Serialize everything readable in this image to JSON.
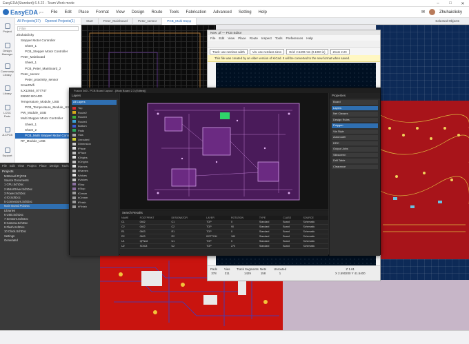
{
  "easyeda": {
    "window_title": "EasyEDA(Standard) 6.5.22 - Team Work mode",
    "logo_text": "EasyEDA",
    "logo_sub": "pro",
    "menu": [
      "File",
      "Edit",
      "Place",
      "Format",
      "View",
      "Design",
      "Route",
      "Tools",
      "Fabrication",
      "Advanced",
      "Setting",
      "Help"
    ],
    "username": "Zhuhaiclicky",
    "left_rail": [
      "Project",
      "Design Manager",
      "Commonly Library",
      "Library",
      "LCSC Parts",
      "JLCPCB",
      "Support"
    ],
    "project_tabs": [
      "All Projects(37)",
      "Opened Projects(1)"
    ],
    "filter_placeholder": "Filter",
    "tree": [
      "Zhuhaiclicky",
      "Stepper Motor Controller",
      "Sheet_1",
      "PCB_Stepper Motor Controller",
      "Peter_Mainboard",
      "Sheet_1",
      "PCB_Peter_Mainboard_2",
      "Peter_sensor",
      "Peter_proximity_sensor",
      "SmartWifi",
      "ILX12654_077747",
      "EB000 BOARD",
      "Temperature_Module_USB",
      "PCB_Temperature_Module_USB",
      "PW_Module_USB",
      "Multi Stepper Motor Controller",
      "Sheet_1",
      "Sheet_2",
      "PCB_Multi Stepper Motor Controller",
      "RF_Module_USB"
    ],
    "tabs": [
      "Start",
      "Peter_Mainboard",
      "Peter_sensor",
      "PCB_Multi Stepp"
    ],
    "selected_objects_label": "Selected Objects"
  },
  "altium": {
    "menu": [
      "File",
      "Edit",
      "View",
      "Project",
      "Place",
      "Design",
      "Tools",
      "Route",
      "Reports"
    ],
    "projects_label": "Projects",
    "rows": [
      "MSBoard.PrjPCB",
      "Source Documents",
      "1 CPU.SchDoc",
      "2 MotorDriver.SchDoc",
      "3 Power.SchDoc",
      "4 IO.SchDoc",
      "5 Connectors.SchDoc",
      "Main Board.PcbDoc",
      "Libraries",
      "6 USB.SchDoc",
      "7 Sensors.SchDoc",
      "8 Camera.SchDoc",
      "9 Flash.SchDoc",
      "10 Clock.SchDoc",
      "Settings",
      "Generated"
    ],
    "selected_index": 7,
    "footer": "Project Group 1.DsnWrk"
  },
  "kicad": {
    "title": "New .pf — PCB Editor",
    "menu": [
      "File",
      "Edit",
      "View",
      "Place",
      "Route",
      "Inspect",
      "Tools",
      "Preferences",
      "Help"
    ],
    "track_select": "Track: use netclass width",
    "via_select": "Via: use netclass sizes",
    "grid_select": "Grid: 2.5400 mm (0.1000 in)",
    "zoom_select": "Zoom 2.20",
    "notice": "This file was created by an older version of KiCad. It will be converted to the new format when saved.",
    "board_text": "ALL VIAS MUST BE TENTED",
    "status": [
      {
        "label": "Pads",
        "value": "378"
      },
      {
        "label": "Vias",
        "value": "311"
      },
      {
        "label": "Track Segments",
        "value": "1429"
      },
      {
        "label": "Nets",
        "value": "158"
      },
      {
        "label": "Unrouted",
        "value": "1"
      }
    ],
    "coord_z": "Z 1.61",
    "coord_xy": "X 2.590200  Y 41.5400"
  },
  "eagle": {
    "title": "Fusion 360 - PCB Board Layout - [Main Board 2.3 (Edited)]",
    "layers_title": "Layers",
    "layer_filter": "All Layers",
    "layers": [
      {
        "name": "Top",
        "color": "#d63030"
      },
      {
        "name": "Route2",
        "color": "#d4a81a"
      },
      {
        "name": "Route3",
        "color": "#3caf3c"
      },
      {
        "name": "Route4",
        "color": "#3ca0d4"
      },
      {
        "name": "Bottom",
        "color": "#3a5cd4"
      },
      {
        "name": "Pads",
        "color": "#2aa85a"
      },
      {
        "name": "Vias",
        "color": "#aaaaaa"
      },
      {
        "name": "Unrouted",
        "color": "#d0d030"
      },
      {
        "name": "Dimension",
        "color": "#cccccc"
      },
      {
        "name": "tPlace",
        "color": "#e0e0e0"
      },
      {
        "name": "bPlace",
        "color": "#c0c0c0"
      },
      {
        "name": "tOrigins",
        "color": "#e0e0e0"
      },
      {
        "name": "bOrigins",
        "color": "#c0c0c0"
      },
      {
        "name": "tNames",
        "color": "#e0e0e0"
      },
      {
        "name": "bNames",
        "color": "#c0c0c0"
      },
      {
        "name": "tValues",
        "color": "#e0e0e0"
      },
      {
        "name": "bValues",
        "color": "#c0c0c0"
      },
      {
        "name": "tStop",
        "color": "#8a6fa0"
      },
      {
        "name": "bStop",
        "color": "#8a6fa0"
      },
      {
        "name": "tCream",
        "color": "#9a9a9a"
      },
      {
        "name": "bCream",
        "color": "#9a9a9a"
      },
      {
        "name": "tFinish",
        "color": "#9a9a9a"
      },
      {
        "name": "bFinish",
        "color": "#9a9a9a"
      }
    ],
    "properties_title": "Properties",
    "properties": [
      "Board",
      "Layers",
      "Net Classes",
      "Design Rules",
      "Polygon",
      "Via Style",
      "Autorouter",
      "DRC",
      "Output Jobs",
      "Silkscreen",
      "Drill Table",
      "Clearance"
    ],
    "search_title": "Search Results",
    "search_headers": [
      "NAME",
      "FOOTPRINT",
      "DESIGNATOR",
      "LAYER",
      "ROTATION",
      "TYPE",
      "CLASS",
      "SOURCE"
    ],
    "search_rows": [
      [
        "C1",
        "0402",
        "C1",
        "TOP",
        "0",
        "Standard",
        "Board",
        "Schematic"
      ],
      [
        "C2",
        "0402",
        "C2",
        "TOP",
        "90",
        "Standard",
        "Board",
        "Schematic"
      ],
      [
        "R1",
        "0603",
        "R1",
        "TOP",
        "0",
        "Standard",
        "Board",
        "Schematic"
      ],
      [
        "R2",
        "0603",
        "R2",
        "BOTTOM",
        "180",
        "Standard",
        "Board",
        "Schematic"
      ],
      [
        "U1",
        "QFN48",
        "U1",
        "TOP",
        "0",
        "Standard",
        "Board",
        "Schematic"
      ],
      [
        "U2",
        "SOIC8",
        "U2",
        "TOP",
        "270",
        "Standard",
        "Board",
        "Schematic"
      ]
    ]
  }
}
